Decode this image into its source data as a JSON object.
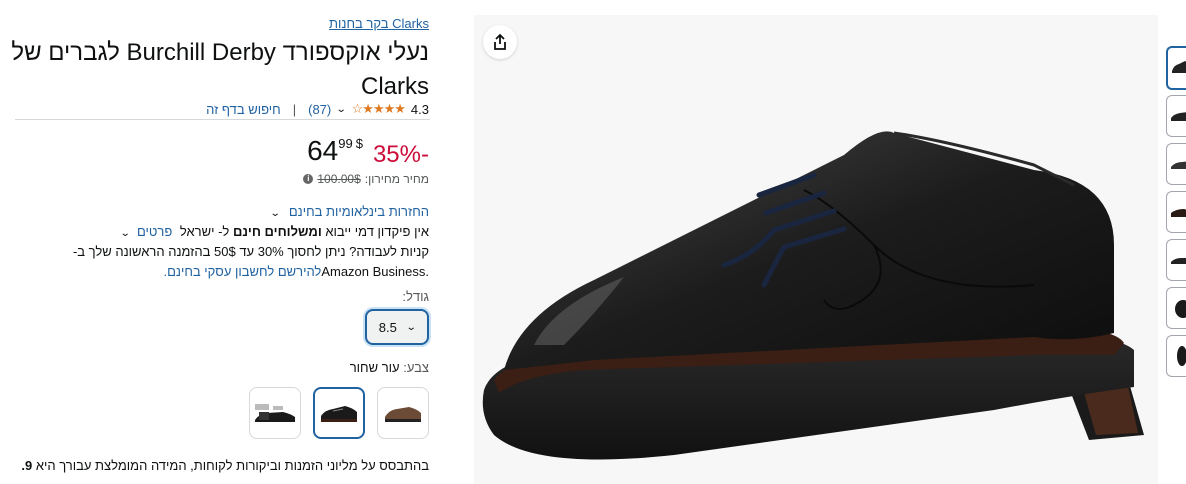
{
  "store_link": "בקר בחנות Clarks",
  "title": "נעלי אוקספורד Burchill Derby לגברים של Clarks",
  "rating": {
    "value": "4.3",
    "stars": "★★★★☆",
    "count": "(87)",
    "separator": "|",
    "search_link": "חיפוש בדף זה"
  },
  "price": {
    "discount": "-35%",
    "currency": "$",
    "whole": "64",
    "fraction": "99",
    "list_label": "מחיר מחירון:",
    "list_value": "100.00$",
    "info_icon": "i"
  },
  "returns": "החזרות בינלאומיות בחינם",
  "shipping": {
    "text_before": "אין פיקדון דמי ייבוא",
    "bold": "ומשלוחים חינם",
    "text_after": "ל- ישראל",
    "details_link": "פרטים"
  },
  "business": {
    "line1": "קניות לעבודה? ניתן לחסוך 30% עד 50$ בהזמנה הראשונה שלך ב-",
    "line2_text": "Amazon Business.",
    "line2_link": "להירשם לחשבון עסקי בחינם."
  },
  "size": {
    "label": "גודל:",
    "selected": "8.5"
  },
  "color": {
    "label": "צבע:",
    "selected": "עור שחור",
    "swatches": [
      "brown-shoe",
      "black-shoe",
      "shoe-set"
    ]
  },
  "recommendation": {
    "text": "בהתבסס על מליוני הזמנות וביקורות לקוחות, המידה המומלצת עבורך היא",
    "value": "9."
  },
  "icons": {
    "share": "share-icon",
    "chevron": "chevron-down-icon"
  }
}
